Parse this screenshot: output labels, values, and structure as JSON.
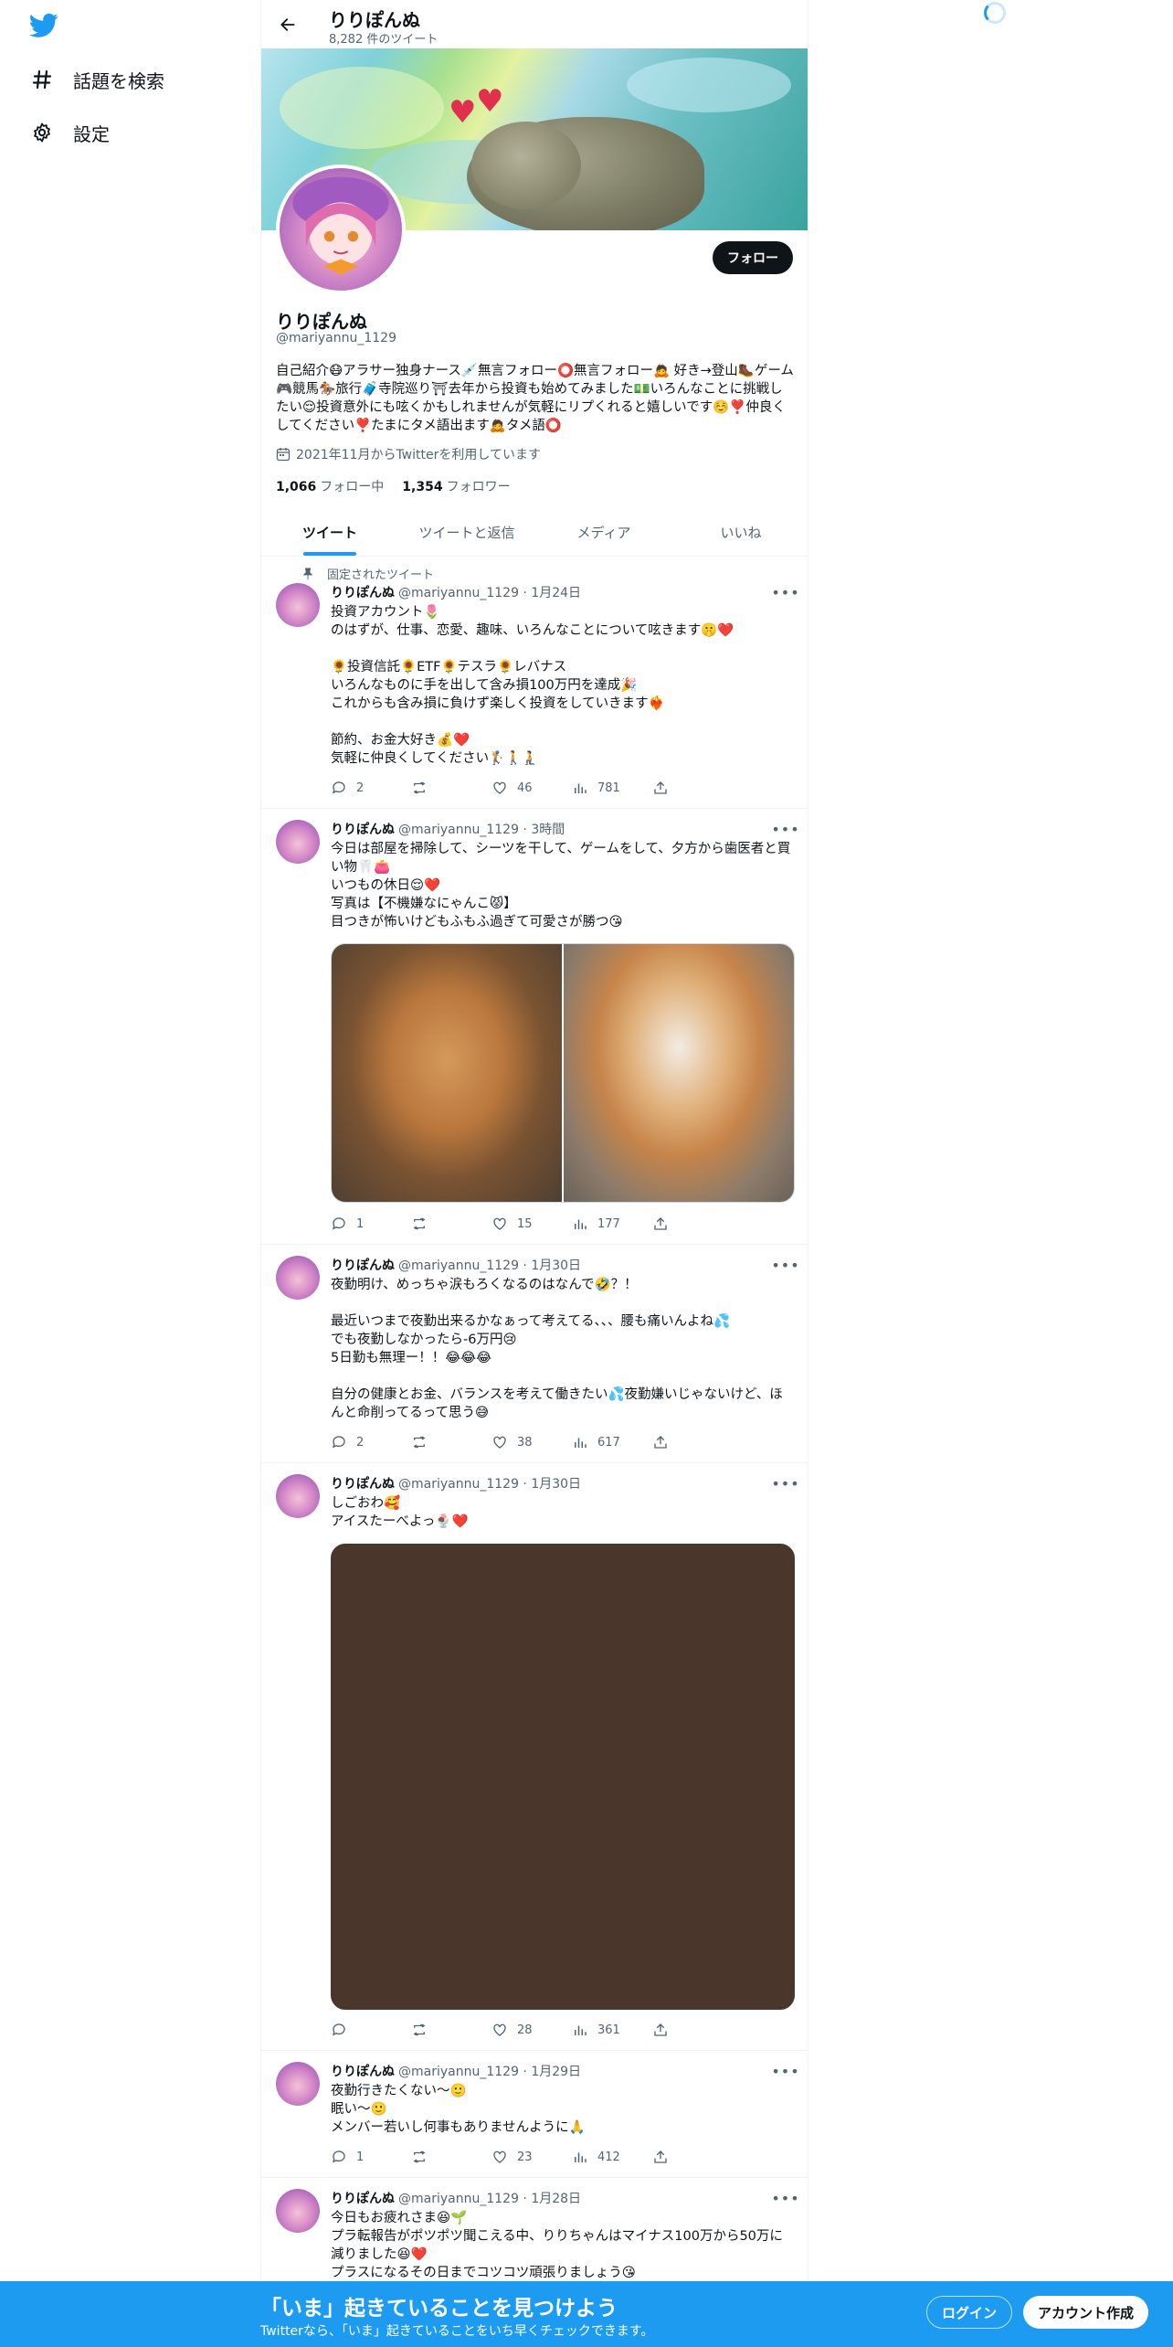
{
  "colors": {
    "accent": "#1d9bf0",
    "text": "#0f1419",
    "muted": "#536471"
  },
  "sidebar": {
    "items": [
      {
        "label": "話題を検索",
        "icon": "hashtag-icon"
      },
      {
        "label": "設定",
        "icon": "gear-icon"
      }
    ]
  },
  "header": {
    "name": "りりぽんぬ",
    "tweet_count": "8,282 件のツイート"
  },
  "profile": {
    "follow_label": "フォロー",
    "name": "りりぽんぬ",
    "handle": "@mariyannu_1129",
    "bio": "自己紹介😷アラサー独身ナース💉無言フォロー⭕️無言フォロー🙇 好き→登山🥾ゲーム🎮競馬🏇旅行🧳寺院巡り⛩去年から投資も始めてみました💵いろんなことに挑戦したい😌投資意外にも呟くかもしれませんが気軽にリプくれると嬉しいです☺️❣️仲良くしてください❣️たまにタメ語出ます🙇タメ語⭕️",
    "joined": "2021年11月からTwitterを利用しています",
    "following_count": "1,066",
    "following_label": "フォロー中",
    "followers_count": "1,354",
    "followers_label": "フォロワー"
  },
  "tabs": [
    "ツイート",
    "ツイートと返信",
    "メディア",
    "いいね"
  ],
  "pinned_label": "固定されたツイート",
  "tweets": [
    {
      "name": "りりぽんぬ",
      "meta": "@mariyannu_1129 · 1月24日",
      "text": "投資アカウント🌷\nのはずが、仕事、恋愛、趣味、いろんなことについて呟きます🤫❤️\n\n🌻投資信託🌻ETF🌻テスラ🌻レバナス\nいろんなものに手を出して含み損100万円を達成🎉\nこれからも含み損に負けず楽しく投資をしていきます❤️‍🔥\n\n節約、お金大好き💰❤️\n気軽に仲良くしてください🏌️🚶🧎",
      "replies": "2",
      "retweets": "",
      "likes": "46",
      "views": "781"
    },
    {
      "name": "りりぽんぬ",
      "meta": "@mariyannu_1129 · 3時間",
      "text": "今日は部屋を掃除して、シーツを干して、ゲームをして、夕方から歯医者と買い物🦷👛\nいつもの休日😌❤️\n写真は【不機嫌なにゃんこ😾】\n目つきが怖いけどもふもふ過ぎて可愛さが勝つ😘",
      "replies": "1",
      "retweets": "",
      "likes": "15",
      "views": "177"
    },
    {
      "name": "りりぽんぬ",
      "meta": "@mariyannu_1129 · 1月30日",
      "text": "夜勤明け、めっちゃ涙もろくなるのはなんで🤣？！\n\n最近いつまで夜勤出来るかなぁって考えてる、、、腰も痛いんよね💦\nでも夜勤しなかったら-6万円😢\n5日勤も無理ー！！😂😂😂\n\n自分の健康とお金、バランスを考えて働きたい💦夜勤嫌いじゃないけど、ほんと命削ってるって思う😅",
      "replies": "2",
      "retweets": "",
      "likes": "38",
      "views": "617"
    },
    {
      "name": "りりぽんぬ",
      "meta": "@mariyannu_1129 · 1月30日",
      "text": "しごおわ🥰\nアイスたーべよっ🍨❤️",
      "replies": "",
      "retweets": "",
      "likes": "28",
      "views": "361"
    },
    {
      "name": "りりぽんぬ",
      "meta": "@mariyannu_1129 · 1月29日",
      "text": "夜勤行きたくない〜🙂\n眠い〜🙂\nメンバー若いし何事もありませんように🙏",
      "replies": "1",
      "retweets": "",
      "likes": "23",
      "views": "412"
    },
    {
      "name": "りりぽんぬ",
      "meta": "@mariyannu_1129 · 1月28日",
      "text": "今日もお疲れさま😆🌱\nプラ転報告がポツポツ聞こえる中、りりちゃんはマイナス100万から50万に減りました😆❤️\nプラスになるその日までコツコツ頑張りましょう😘"
    }
  ],
  "bottom_bar": {
    "title": "「いま」起きていることを見つけよう",
    "subtitle": "Twitterなら、「いま」起きていることをいち早くチェックできます。",
    "login": "ログイン",
    "signup": "アカウント作成"
  }
}
